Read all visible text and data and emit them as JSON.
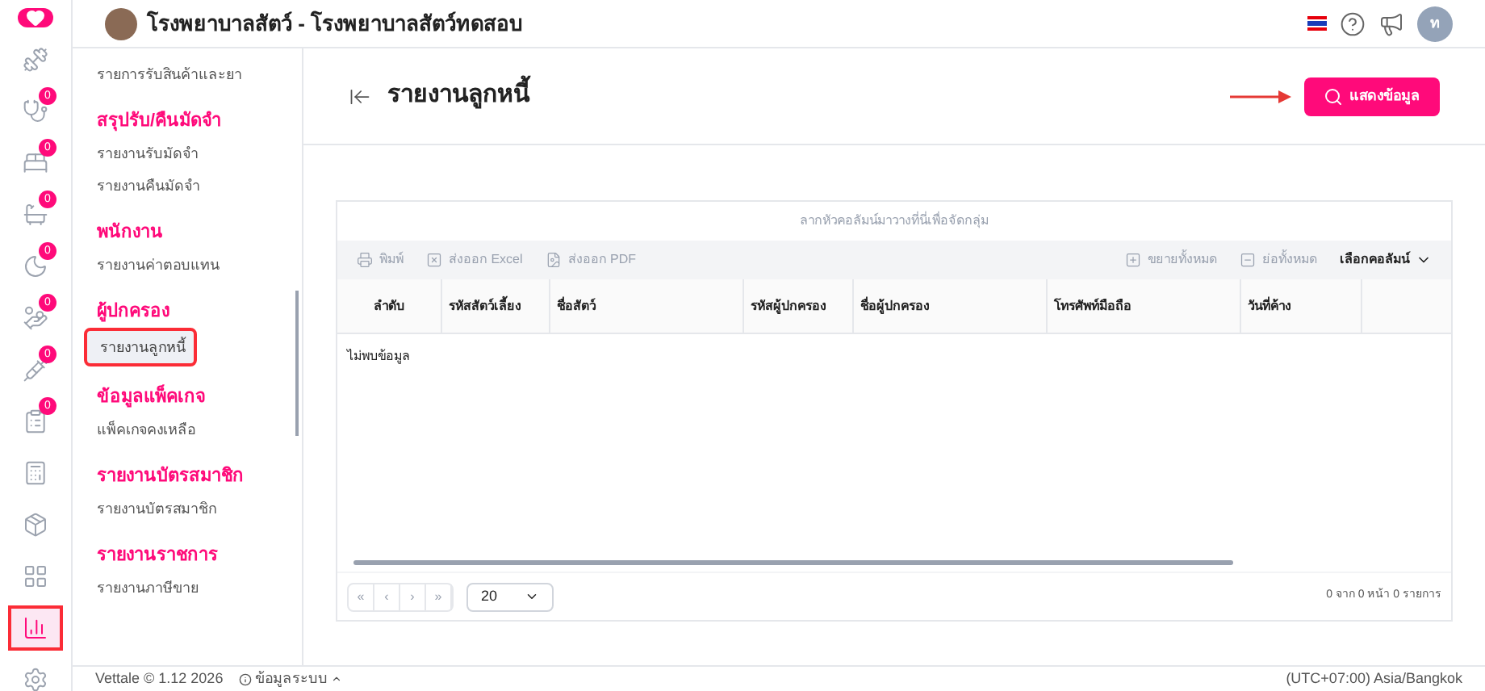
{
  "header": {
    "title": "โรงพยาบาลสัตว์ - โรงพยาบาลสัตว์ทดสอบ",
    "avatar_initial": "ท"
  },
  "rail": [
    {
      "selected": false
    },
    {
      "badge": "0",
      "selected": false
    },
    {
      "badge": "0",
      "selected": false
    },
    {
      "badge": "0",
      "selected": false
    },
    {
      "badge": "0",
      "selected": false
    },
    {
      "badge": "0",
      "selected": false
    },
    {
      "badge": "0",
      "selected": false
    },
    {
      "badge": "0",
      "selected": false
    },
    {
      "selected": false
    },
    {
      "selected": false
    },
    {
      "selected": false
    },
    {
      "selected": true
    },
    {
      "selected": false
    }
  ],
  "menu": [
    {
      "kind": "item",
      "label": "รายการรับสินค้าและยา",
      "selected": false
    },
    {
      "kind": "heading",
      "label": "สรุปรับ/คืนมัดจำ"
    },
    {
      "kind": "item",
      "label": "รายงานรับมัดจำ",
      "selected": false
    },
    {
      "kind": "item",
      "label": "รายงานคืนมัดจำ",
      "selected": false
    },
    {
      "kind": "heading",
      "label": "พนักงาน"
    },
    {
      "kind": "item",
      "label": "รายงานค่าตอบแทน",
      "selected": false
    },
    {
      "kind": "heading",
      "label": "ผู้ปกครอง"
    },
    {
      "kind": "item",
      "label": "รายงานลูกหนี้",
      "selected": true
    },
    {
      "kind": "heading",
      "label": "ข้อมูลแพ็คเกจ"
    },
    {
      "kind": "item",
      "label": "แพ็คเกจคงเหลือ",
      "selected": false
    },
    {
      "kind": "heading",
      "label": "รายงานบัตรสมาชิก"
    },
    {
      "kind": "item",
      "label": "รายงานบัตรสมาชิก",
      "selected": false
    },
    {
      "kind": "heading",
      "label": "รายงานราชการ"
    },
    {
      "kind": "item",
      "label": "รายงานภาษีขาย",
      "selected": false
    }
  ],
  "page": {
    "title": "รายงานลูกหนี้",
    "show_button": "แสดงข้อมูล"
  },
  "grid": {
    "group_hint": "ลากหัวคอลัมน์มาวางที่นี่เพื่อจัดกลุ่ม",
    "toolbar_left": [
      "พิมพ์",
      "ส่งออก Excel",
      "ส่งออก PDF"
    ],
    "toolbar_right": [
      "ขยายทั้งหมด",
      "ย่อทั้งหมด"
    ],
    "column_chooser": "เลือกคอลัมน์",
    "columns": [
      "ลำดับ",
      "รหัสสัตว์เลี้ยง",
      "ชื่อสัตว์",
      "รหัสผู้ปกครอง",
      "ชื่อผู้ปกครอง",
      "โทรศัพท์มือถือ",
      "วันที่ค้าง"
    ],
    "empty": "ไม่พบข้อมูล",
    "pager": [
      "«",
      "‹",
      "›",
      "»"
    ],
    "page_size": "20",
    "summary": "0 จาก 0 หน้า 0 รายการ"
  },
  "footer": {
    "version": "Vettale © 1.12 2026",
    "system_info": "ข้อมูลระบบ",
    "timezone": "(UTC+07:00) Asia/Bangkok"
  }
}
